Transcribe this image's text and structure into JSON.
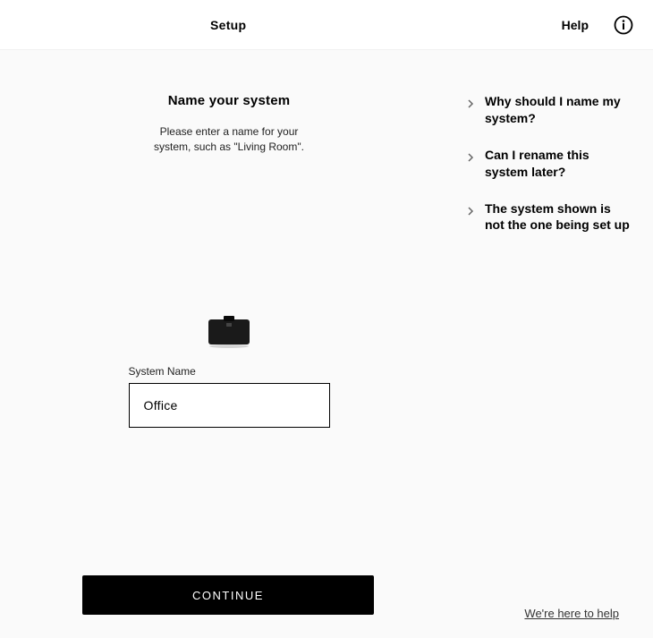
{
  "header": {
    "title": "Setup",
    "help_label": "Help"
  },
  "main": {
    "title": "Name your system",
    "subtitle_line1": "Please enter a name for your",
    "subtitle_line2": "system, such as \"Living Room\".",
    "field_label": "System Name",
    "field_value": "Office",
    "continue_label": "CONTINUE"
  },
  "faq": {
    "items": [
      {
        "text": "Why should I name my system?"
      },
      {
        "text": "Can I rename this system later?"
      },
      {
        "text": "The system shown is not the one being set up"
      }
    ]
  },
  "footer": {
    "help_text": "We're here to help"
  }
}
